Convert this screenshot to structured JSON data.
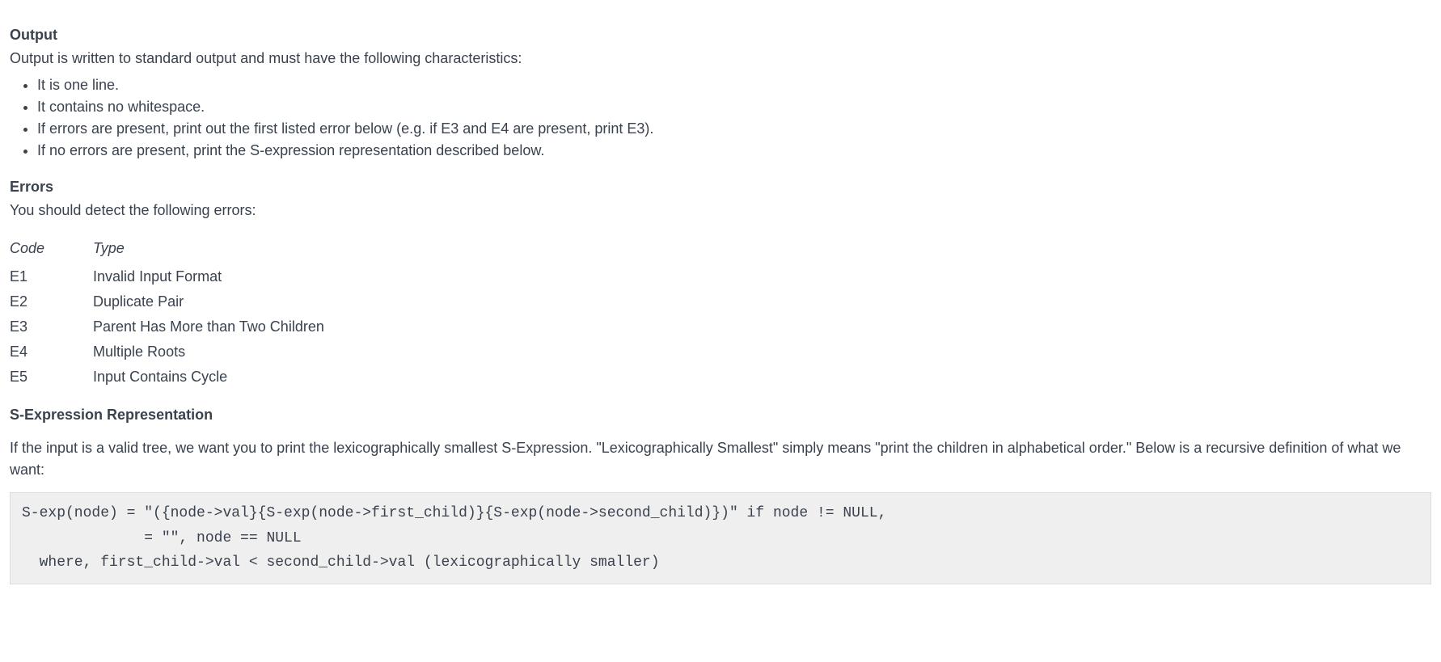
{
  "output": {
    "heading": "Output",
    "intro": "Output is written to standard output and must have the following characteristics:",
    "bullets": [
      "It is one line.",
      "It contains no whitespace.",
      "If errors are present, print out the first listed error below (e.g. if E3 and E4 are present, print E3).",
      "If no errors are present, print the S-expression representation described below."
    ]
  },
  "errors": {
    "heading": "Errors",
    "intro": "You should detect the following errors:",
    "table": {
      "header_code": "Code",
      "header_type": "Type",
      "rows": [
        {
          "code": "E1",
          "type": "Invalid Input Format"
        },
        {
          "code": "E2",
          "type": "Duplicate Pair"
        },
        {
          "code": "E3",
          "type": "Parent Has More than Two Children"
        },
        {
          "code": "E4",
          "type": "Multiple Roots"
        },
        {
          "code": "E5",
          "type": "Input Contains Cycle"
        }
      ]
    }
  },
  "sexp": {
    "heading": "S-Expression Representation",
    "para": "If the input is a valid tree, we want you to print the lexicographically smallest S-Expression. \"Lexicographically Smallest\" simply means \"print the children in alphabetical order.\" Below is a recursive definition of what we want:",
    "code": "S-exp(node) = \"({node->val}{S-exp(node->first_child)}{S-exp(node->second_child)})\" if node != NULL,\n              = \"\", node == NULL\n  where, first_child->val < second_child->val (lexicographically smaller)"
  }
}
